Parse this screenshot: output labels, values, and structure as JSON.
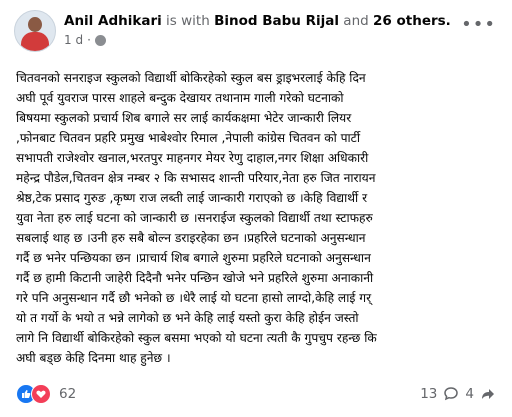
{
  "post": {
    "author": "Anil Adhikari",
    "with_text": "is with",
    "tagged": "Binod Babu Rijal",
    "and_text": "and",
    "others": "26 others.",
    "time": "1 d",
    "privacy_icon": "globe-icon",
    "more_icon": "more-options-icon"
  },
  "body": {
    "lines": [
      "चितवनको सनराइज स्कुलको विद्यार्थी बोकिरहेको  स्कुल बस ड्राइभरलाई केहि दिन",
      "अघी पूर्व युवराज पारस शाहले बन्दुक देखायर तथानाम गाली गरेको घटनाको",
      "बिषयमा स्कुलको प्रचार्य शिब बगाले सर लाई कार्यकक्षमा भेटेर जान्कारी लियर",
      ",फोनबाट चितवन प्रहरि प्रमुख भाबेश्वोर रिमाल ,नेपाली कांग्रेस चितवन को पार्टी",
      "सभापती राजेश्वोर खनाल,भरतपुर माहनगर मेयर रेणु दाहाल,नगर शिक्षा अधिकारी",
      "महेन्द्र पौडेल,चितवन क्षेत्र नम्बर २ कि सभासद शान्ती परियार,नेता हरु जित नारायन",
      "श्रेष्ठ,टेक प्रसाद गुरुङ ,कृष्ण राज लब्ती लाई जान्कारी गराएको छ ।केहि विद्यार्थी र",
      "युवा नेता हरु लाई घटना को जान्कारी छ ।सनराईज स्कुलको विद्यार्थी तथा स्टाफहरु",
      "सबलाई थाह छ ।उनी हरु सबै बोल्न डराइरहेका छन ।प्रहरिले घटनाको अनुसन्धान",
      "गर्दै छ भनेर पन्छियका छन ।प्राचार्य शिब बगाले शुरुमा प्रहरिले घटनाको अनुसन्धान",
      "गर्दै छ हामी किटानी जाहेरी दिदैनौ भनेर पन्छिन खोजे भने प्रहरिले शुरुमा अनाकानी",
      "गरे पनि अनुसन्धान गर्दै छौ भनेको छ ।धेरै लाई यो घटना हासो लाग्दो,केहि लाई गर्",
      "यो त गर्यो के भयो त भन्ने लागेको छ भने केहि लाई यस्तो कुरा केहि होईन जस्तो",
      "लागे नि विद्यार्थी बोकिरहेको स्कुल बसमा भएको यो घटना त्यती कै गुपचुप रहन्छ कि",
      "अघी बड्छ केहि दिनमा थाह हुनेछ ।"
    ]
  },
  "footer": {
    "reaction_count": "62",
    "comment_count": "13",
    "share_count": "4",
    "like_icon": "like-reaction-icon",
    "love_icon": "love-reaction-icon",
    "comment_icon": "comment-icon",
    "share_icon": "share-icon",
    "colors": {
      "like": "#1877f2",
      "love": "#f33e58"
    }
  }
}
